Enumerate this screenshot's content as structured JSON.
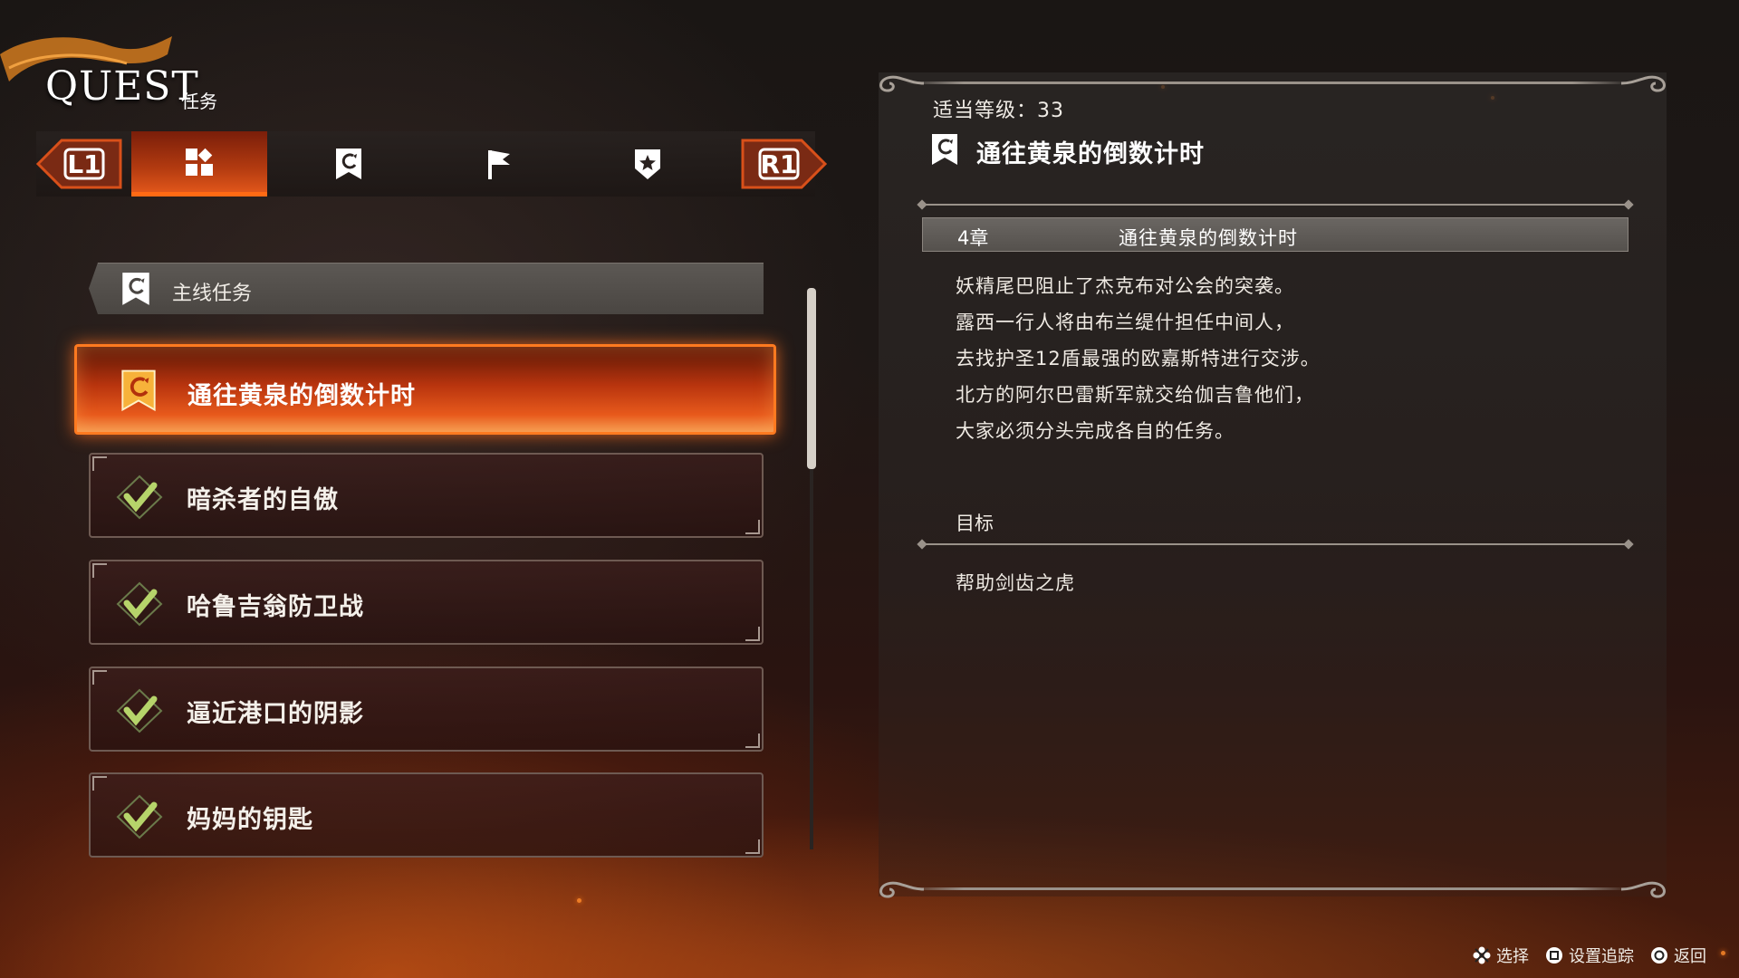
{
  "header": {
    "title": "QUEST",
    "subtitle": "任务"
  },
  "tabs": {
    "left_shoulder": "L1",
    "right_shoulder": "R1",
    "items": [
      {
        "icon": "all-quests-icon",
        "active": true
      },
      {
        "icon": "main-quest-icon",
        "active": false
      },
      {
        "icon": "flag-icon",
        "active": false
      },
      {
        "icon": "star-badge-icon",
        "active": false
      }
    ]
  },
  "list": {
    "category": {
      "icon": "main-quest-icon",
      "label": "主线任务"
    },
    "quests": [
      {
        "title": "通往黄泉的倒数计时",
        "status": "active",
        "icon": "main-quest-icon"
      },
      {
        "title": "暗杀者的自傲",
        "status": "completed",
        "icon": "check-icon"
      },
      {
        "title": "哈鲁吉翁防卫战",
        "status": "completed",
        "icon": "check-icon"
      },
      {
        "title": "逼近港口的阴影",
        "status": "completed",
        "icon": "check-icon"
      },
      {
        "title": "妈妈的钥匙",
        "status": "completed",
        "icon": "check-icon"
      }
    ]
  },
  "detail": {
    "level_text": "适当等级：33",
    "title": "通往黄泉的倒数计时",
    "chapter": "4章",
    "chapter_title": "通往黄泉的倒数计时",
    "description": [
      "妖精尾巴阻止了杰克布对公会的突袭。",
      "露西一行人将由布兰缇什担任中间人，",
      "去找护圣12盾最强的欧嘉斯特进行交涉。",
      "北方的阿尔巴雷斯军就交给伽吉鲁他们，",
      "大家必须分头完成各自的任务。"
    ],
    "objective_heading": "目标",
    "objective": "帮助剑齿之虎"
  },
  "footer": {
    "hints": [
      {
        "icon": "cross-button-icon",
        "label": "选择"
      },
      {
        "icon": "square-button-icon",
        "label": "设置追踪"
      },
      {
        "icon": "circle-button-icon",
        "label": "返回"
      }
    ]
  },
  "colors": {
    "accent": "#ff6a14",
    "check": "#9ec25a"
  }
}
